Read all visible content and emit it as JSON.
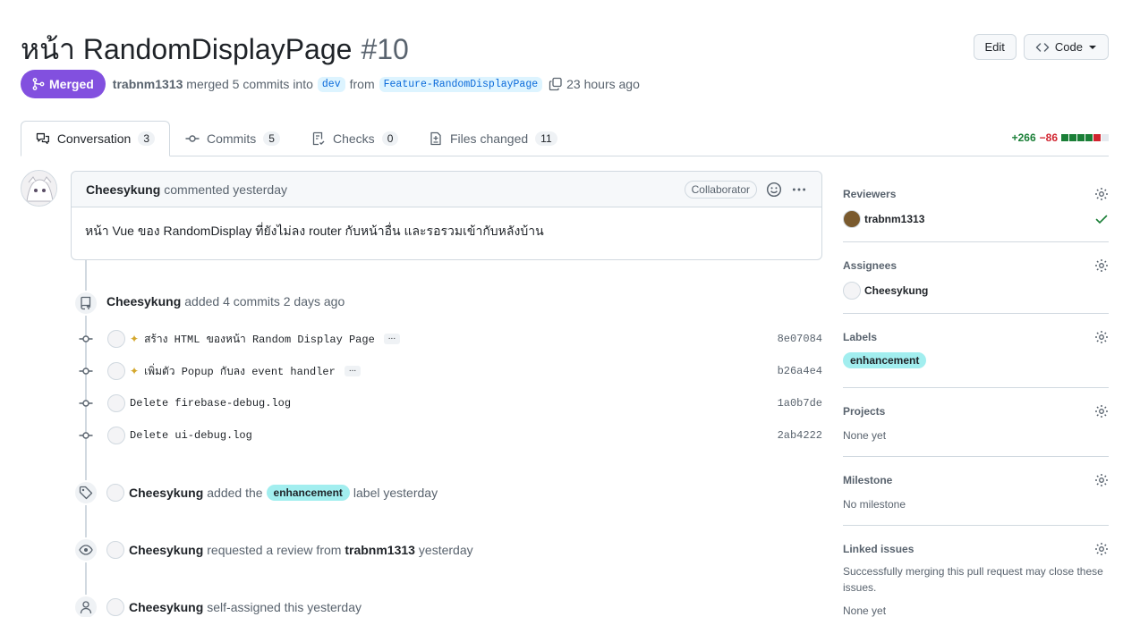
{
  "header": {
    "title": "หน้า RandomDisplayPage",
    "number": "#10",
    "edit_label": "Edit",
    "code_label": "Code"
  },
  "state": {
    "badge": "Merged",
    "author": "trabnm1313",
    "merged_text": "merged 5 commits into",
    "base_branch": "dev",
    "from_text": "from",
    "head_branch": "Feature-RandomDisplayPage",
    "time": "23 hours ago"
  },
  "tabs": [
    {
      "label": "Conversation",
      "count": "3"
    },
    {
      "label": "Commits",
      "count": "5"
    },
    {
      "label": "Checks",
      "count": "0"
    },
    {
      "label": "Files changed",
      "count": "11"
    }
  ],
  "diffstat": {
    "additions": "+266",
    "deletions": "−86"
  },
  "comment": {
    "author": "Cheesykung",
    "action": "commented yesterday",
    "role": "Collaborator",
    "body": "หน้า Vue ของ RandomDisplay ที่ยังไม่ลง router กับหน้าอื่น และรอรวมเข้ากับหลังบ้าน"
  },
  "commits_event": {
    "author": "Cheesykung",
    "text": "added 4 commits 2 days ago"
  },
  "commits": [
    {
      "message": "สร้าง HTML ของหน้า Random Display Page",
      "sha": "8e07084",
      "sparkle": true,
      "more": "..."
    },
    {
      "message": "เพิ่มตัว Popup กับลง event handler",
      "sha": "b26a4e4",
      "sparkle": true,
      "more": "..."
    },
    {
      "message": "Delete firebase-debug.log",
      "sha": "1a0b7de",
      "sparkle": false
    },
    {
      "message": "Delete ui-debug.log",
      "sha": "2ab4222",
      "sparkle": false
    }
  ],
  "label_event": {
    "author": "Cheesykung",
    "pre": "added the",
    "label": "enhancement",
    "post": "label yesterday"
  },
  "review_event": {
    "author": "Cheesykung",
    "pre": "requested a review from",
    "reviewer": "trabnm1313",
    "post": "yesterday"
  },
  "assign_event": {
    "author": "Cheesykung",
    "text": "self-assigned this yesterday"
  },
  "sidebar": {
    "reviewers_title": "Reviewers",
    "reviewer": "trabnm1313",
    "assignees_title": "Assignees",
    "assignee": "Cheesykung",
    "labels_title": "Labels",
    "label": "enhancement",
    "projects_title": "Projects",
    "projects_value": "None yet",
    "milestone_title": "Milestone",
    "milestone_value": "No milestone",
    "linked_title": "Linked issues",
    "linked_desc": "Successfully merging this pull request may close these issues.",
    "linked_value": "None yet"
  },
  "colors": {
    "merged": "#8250df",
    "label": "#a2eeef",
    "add": "#1a7f37",
    "del": "#d1242f"
  }
}
